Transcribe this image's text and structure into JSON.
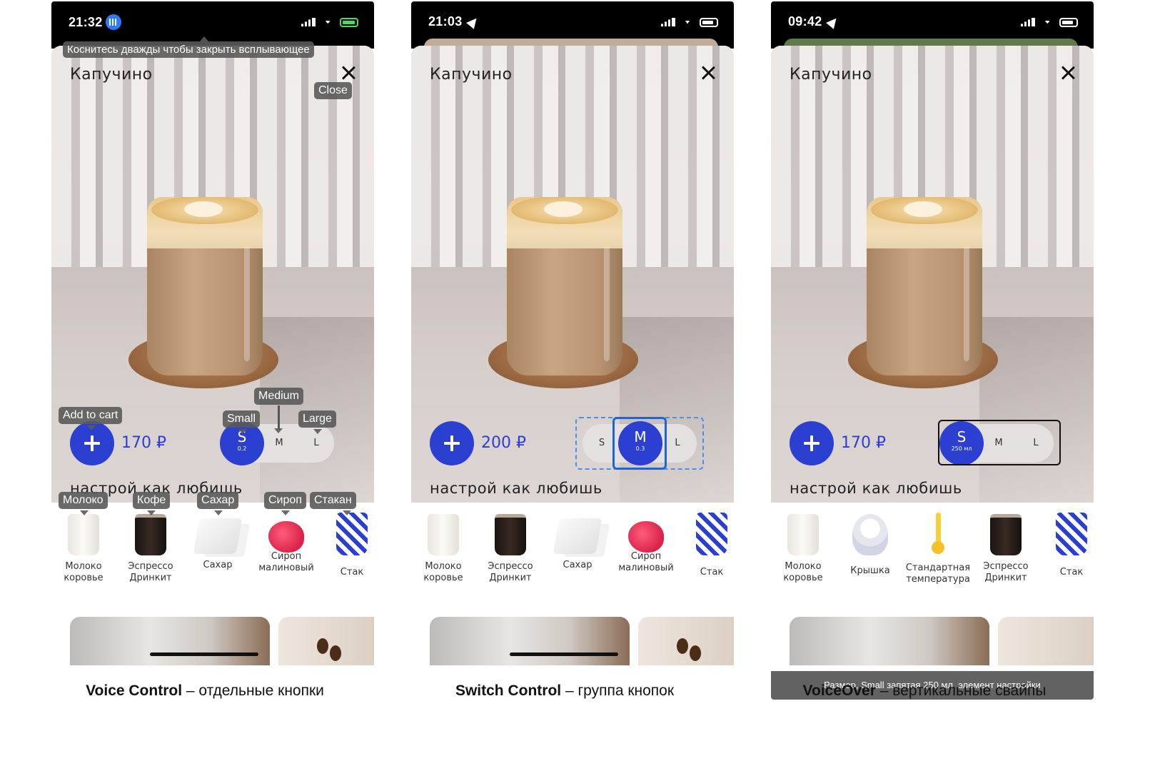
{
  "panels": [
    {
      "time": "21:32",
      "title": "Капучино",
      "price": "170 ₽",
      "sizes": {
        "s": "S",
        "s_sub": "0.2",
        "m": "M",
        "l": "L"
      },
      "subtitle": "настрой как любишь",
      "ingredients": [
        {
          "line1": "Молоко",
          "line2": "коровье",
          "icon": "milk-jar-icon"
        },
        {
          "line1": "Эспрессо",
          "line2": "Дринкит",
          "icon": "espresso-icon"
        },
        {
          "line1": "Сахар",
          "line2": "",
          "icon": "sugar-icon"
        },
        {
          "line1": "Сироп",
          "line2": "малиновый",
          "icon": "syrup-icon"
        },
        {
          "line1": "Стак",
          "line2": "",
          "icon": "cup-icon"
        }
      ],
      "tooltips": {
        "dismiss": "Коснитесь дважды чтобы закрыть всплывающее",
        "close": "Close",
        "add": "Add to cart",
        "small": "Small",
        "medium": "Medium",
        "large": "Large",
        "milk": "Молоко",
        "coffee": "Кофе",
        "sugar": "Сахар",
        "syrup": "Сироп",
        "cup": "Стакан"
      }
    },
    {
      "time": "21:03",
      "title": "Капучино",
      "price": "200 ₽",
      "sizes": {
        "s": "S",
        "m": "M",
        "m_sub": "0.3",
        "l": "L"
      },
      "subtitle": "настрой как любишь",
      "ingredients": [
        {
          "line1": "Молоко",
          "line2": "коровье",
          "icon": "milk-jar-icon"
        },
        {
          "line1": "Эспрессо",
          "line2": "Дринкит",
          "icon": "espresso-icon"
        },
        {
          "line1": "Сахар",
          "line2": "",
          "icon": "sugar-icon"
        },
        {
          "line1": "Сироп",
          "line2": "малиновый",
          "icon": "syrup-icon"
        },
        {
          "line1": "Стак",
          "line2": "",
          "icon": "cup-icon"
        }
      ]
    },
    {
      "time": "09:42",
      "title": "Капучино",
      "price": "170 ₽",
      "sizes": {
        "s": "S",
        "s_sub": "250 мл",
        "m": "M",
        "l": "L"
      },
      "subtitle": "настрой как любишь",
      "ingredients": [
        {
          "line1": "Молоко",
          "line2": "коровье",
          "icon": "milk-jar-icon"
        },
        {
          "line1": "Крышка",
          "line2": "",
          "icon": "lid-icon"
        },
        {
          "line1": "Стандартная",
          "line2": "температура",
          "icon": "thermometer-icon"
        },
        {
          "line1": "Эспрессо",
          "line2": "Дринкит",
          "icon": "espresso-icon"
        },
        {
          "line1": "Стак",
          "line2": "",
          "icon": "cup-icon"
        }
      ],
      "voiceover_caption": "Размер, Small запятая  250 мл, элемент настройки"
    }
  ],
  "captions": [
    {
      "bold": "Voice Control",
      "rest": " – отдельные кнопки"
    },
    {
      "bold": "Switch Control",
      "rest": " – группа кнопок"
    },
    {
      "bold": "VoiceOver",
      "rest": " – вертикальные свайпы"
    }
  ],
  "colors": {
    "accent": "#2b3fd0",
    "switch_focus": "#1f63d8",
    "switch_group": "#4f8fe8",
    "tooltip_bg": "#5a5a5a",
    "status_bar": "#000000"
  }
}
